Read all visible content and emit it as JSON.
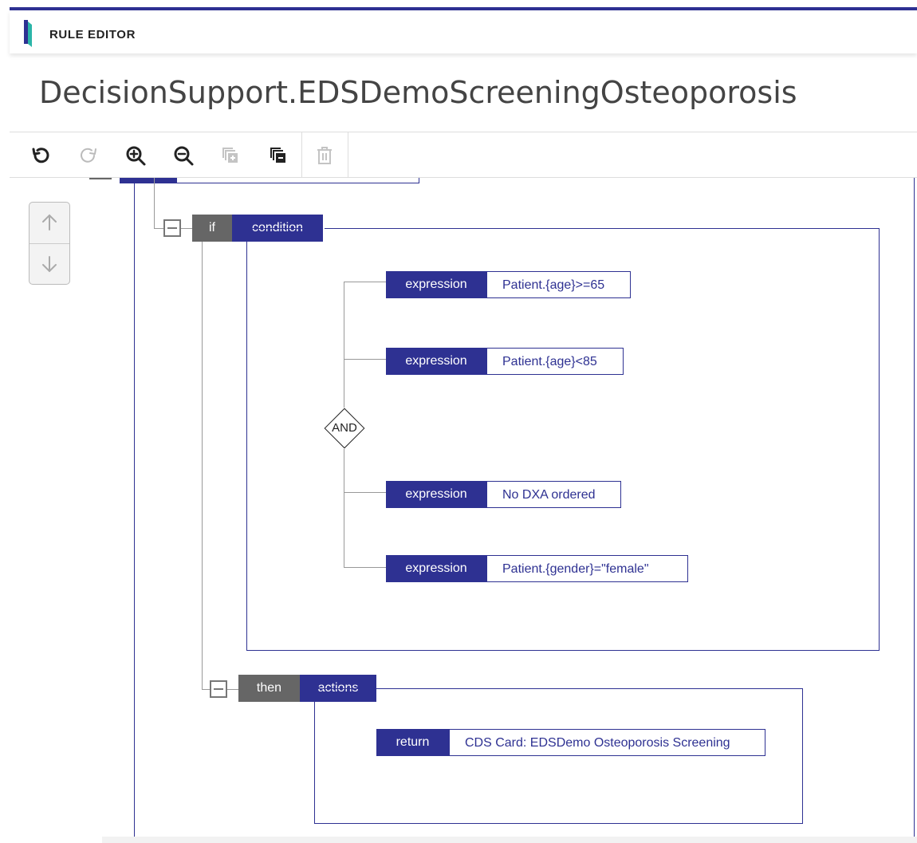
{
  "app": {
    "title": "RULE EDITOR"
  },
  "page": {
    "title": "DecisionSupport.EDSDemoScreeningOsteoporosis"
  },
  "toolbar": {
    "buttons": [
      {
        "name": "undo",
        "icon": "undo-icon",
        "enabled": true
      },
      {
        "name": "redo",
        "icon": "redo-icon",
        "enabled": false
      },
      {
        "name": "zoom-in",
        "icon": "zoom-in-icon",
        "enabled": true
      },
      {
        "name": "zoom-out",
        "icon": "zoom-out-icon",
        "enabled": true
      },
      {
        "name": "expand-all",
        "icon": "expand-all-icon",
        "enabled": false
      },
      {
        "name": "collapse-all",
        "icon": "collapse-all-icon",
        "enabled": true
      },
      {
        "name": "delete",
        "icon": "trash-icon",
        "enabled": false
      }
    ]
  },
  "nav": {
    "up_icon": "arrow-up-icon",
    "down_icon": "arrow-down-icon"
  },
  "rule": {
    "if_block": {
      "keyword": "if",
      "label": "condition",
      "operator": "AND",
      "expressions": [
        {
          "label": "expression",
          "value": "Patient.{age}>=65"
        },
        {
          "label": "expression",
          "value": "Patient.{age}<85"
        },
        {
          "label": "expression",
          "value": "No DXA ordered"
        },
        {
          "label": "expression",
          "value": "Patient.{gender}=\"female\""
        }
      ]
    },
    "then_block": {
      "keyword": "then",
      "label": "actions",
      "return": {
        "label": "return",
        "value": "CDS Card: EDSDemo Osteoporosis Screening"
      }
    }
  },
  "colors": {
    "accent": "#2e3192",
    "keyword_bg": "#666666",
    "logo_teal": "#2bb5a8"
  }
}
